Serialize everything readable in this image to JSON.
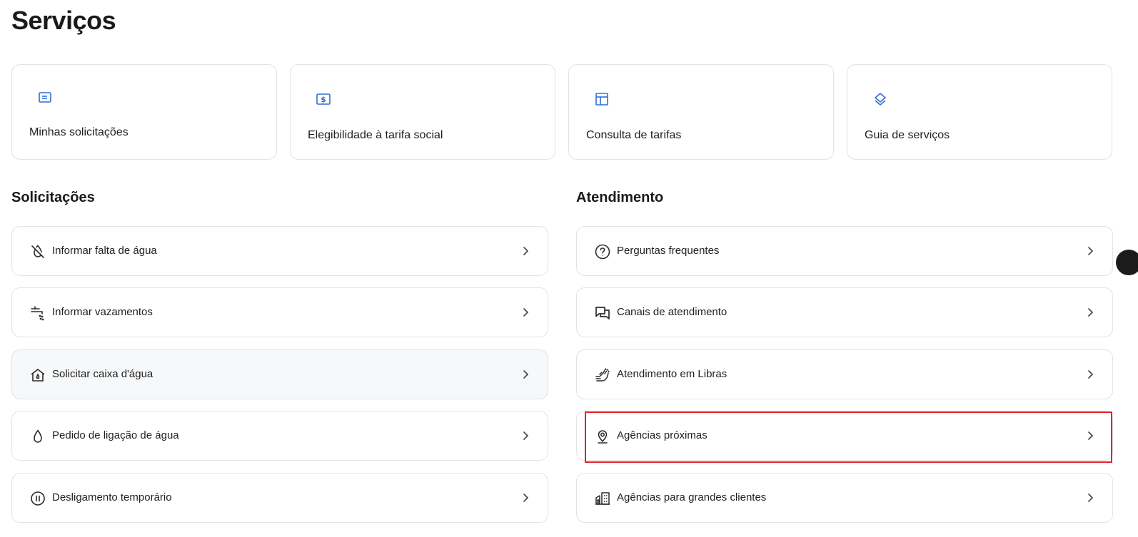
{
  "page": {
    "title": "Serviços"
  },
  "quick_cards": [
    {
      "label": "Minhas solicitações",
      "icon": "card-icon"
    },
    {
      "label": "Elegibilidade à tarifa social",
      "icon": "dollar-icon"
    },
    {
      "label": "Consulta de tarifas",
      "icon": "table-icon"
    },
    {
      "label": "Guia de serviços",
      "icon": "layers-icon"
    }
  ],
  "solicitacoes": {
    "title": "Solicitações",
    "items": [
      {
        "label": "Informar falta de água",
        "icon": "no-water-drop-icon"
      },
      {
        "label": "Informar vazamentos",
        "icon": "faucet-leak-icon"
      },
      {
        "label": "Solicitar caixa d'água",
        "icon": "house-icon"
      },
      {
        "label": "Pedido de ligação de água",
        "icon": "water-drop-icon"
      },
      {
        "label": "Desligamento temporário",
        "icon": "pause-circle-icon"
      }
    ]
  },
  "atendimento": {
    "title": "Atendimento",
    "items": [
      {
        "label": "Perguntas frequentes",
        "icon": "question-circle-icon"
      },
      {
        "label": "Canais de atendimento",
        "icon": "chat-bubbles-icon"
      },
      {
        "label": "Atendimento em Libras",
        "icon": "sign-language-icon"
      },
      {
        "label": "Agências próximas",
        "icon": "map-pin-icon"
      },
      {
        "label": "Agências para grandes clientes",
        "icon": "buildings-icon"
      }
    ]
  },
  "colors": {
    "accent": "#2f6fd6",
    "highlight": "#e0262b",
    "border": "#e3e3e3"
  }
}
